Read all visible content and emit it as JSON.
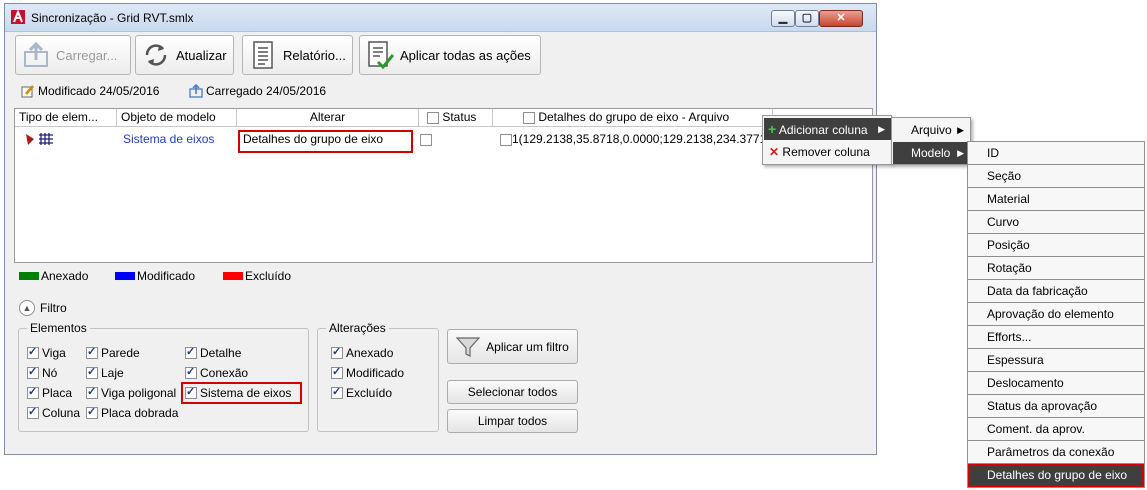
{
  "window": {
    "title": "Sincronização - Grid RVT.smlx"
  },
  "toolbar": {
    "load_label": "Carregar...",
    "refresh_label": "Atualizar",
    "report_label": "Relatório...",
    "apply_all_label": "Aplicar todas as ações"
  },
  "info": {
    "modified": "Modificado 24/05/2016",
    "loaded": "Carregado 24/05/2016"
  },
  "grid": {
    "columns": [
      "Tipo de elem...",
      "Objeto de modelo",
      "Alterar",
      "Status",
      "Detalhes do grupo de eixo - Arquivo"
    ],
    "row": {
      "object": "Sistema de eixos",
      "change": "Detalhes do grupo de eixo",
      "details": "1(129.2138,35.8718,0.0000;129.2138,234.3771,..."
    }
  },
  "legend": [
    {
      "label": "Anexado",
      "color": "#008000"
    },
    {
      "label": "Modificado",
      "color": "#0000ff"
    },
    {
      "label": "Excluído",
      "color": "#ff0000"
    }
  ],
  "filter": {
    "toggle_label": "Filtro",
    "elements_title": "Elementos",
    "elements": [
      "Viga",
      "Nó",
      "Placa",
      "Coluna",
      "Parede",
      "Laje",
      "Viga poligonal",
      "Placa dobrada",
      "Detalhe",
      "Conexão",
      "Sistema de eixos"
    ],
    "changes_title": "Alterações",
    "changes": [
      "Anexado",
      "Modificado",
      "Excluído"
    ],
    "apply_filter": "Aplicar um filtro",
    "select_all": "Selecionar todos",
    "clear_all": "Limpar todos"
  },
  "context_menu": {
    "add_column": "Adicionar coluna",
    "remove_column": "Remover coluna",
    "sub": [
      "Arquivo",
      "Modelo"
    ],
    "model_items": [
      "ID",
      "Seção",
      "Material",
      "Curvo",
      "Posição",
      "Rotação",
      "Data da fabricação",
      "Aprovação do elemento",
      "Efforts...",
      "Espessura",
      "Deslocamento",
      "Status da aprovação",
      "Coment. da aprov.",
      "Parâmetros da conexão",
      "Detalhes do grupo de eixo"
    ]
  }
}
